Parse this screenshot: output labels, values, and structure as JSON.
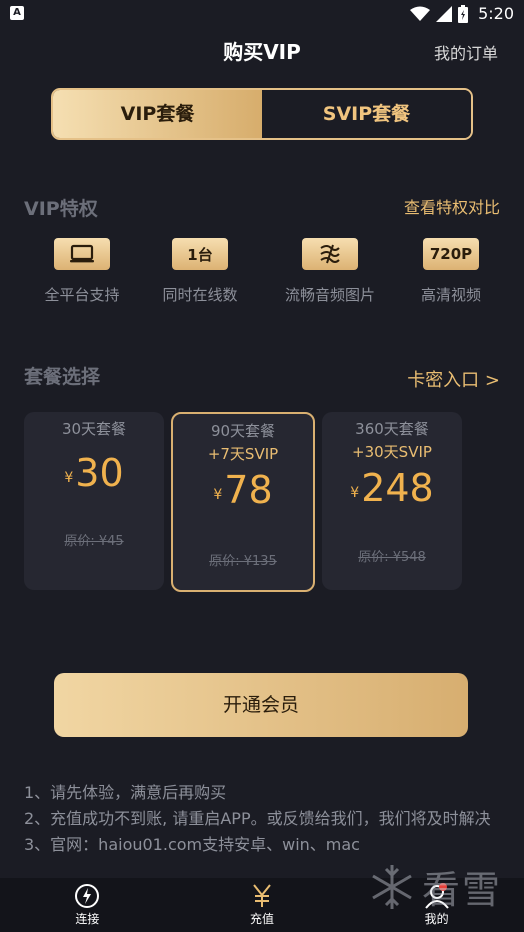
{
  "status_bar": {
    "time": "5:20",
    "app_icon_letter": "A"
  },
  "header": {
    "title": "购买VIP",
    "orders_link": "我的订单"
  },
  "tabs": [
    {
      "label": "VIP套餐",
      "active": true
    },
    {
      "label": "SVIP套餐",
      "active": false
    }
  ],
  "privileges": {
    "title": "VIP特权",
    "compare_link": "查看特权对比",
    "items": [
      {
        "badge": "",
        "label": "全平台支持",
        "icon": "laptop-icon"
      },
      {
        "badge": "1台",
        "label": "同时在线数",
        "icon": ""
      },
      {
        "badge": "",
        "label": "流畅音频图片",
        "icon": "stream-icon"
      },
      {
        "badge": "720P",
        "label": "高清视频",
        "icon": ""
      }
    ]
  },
  "plans": {
    "title": "套餐选择",
    "card_key_link": "卡密入口 >",
    "currency": "¥",
    "items": [
      {
        "name": "30天套餐",
        "bonus": "",
        "price": "30",
        "original": "原价: ¥45",
        "selected": false
      },
      {
        "name": "90天套餐",
        "bonus": "+7天SVIP",
        "price": "78",
        "original": "原价: ¥135",
        "selected": true
      },
      {
        "name": "360天套餐",
        "bonus": "+30天SVIP",
        "price": "248",
        "original": "原价: ¥548",
        "selected": false
      }
    ]
  },
  "cta": {
    "label": "开通会员"
  },
  "notes": {
    "line1": "1、请先体验，满意后再购买",
    "line2": "2、充值成功不到账, 请重启APP。或反馈给我们，我们将及时解决",
    "line3": "3、官网：haiou01.com支持安卓、win、mac"
  },
  "bottom_nav": [
    {
      "label": "连接",
      "icon": "bolt-circle-icon"
    },
    {
      "label": "充值",
      "icon": "yuan-icon"
    },
    {
      "label": "我的",
      "icon": "user-icon"
    }
  ],
  "watermark": {
    "text": "看雪"
  },
  "colors": {
    "gold": "#e9bd72",
    "background": "#1b1c24",
    "card": "#262731",
    "price": "#f0b24e"
  }
}
